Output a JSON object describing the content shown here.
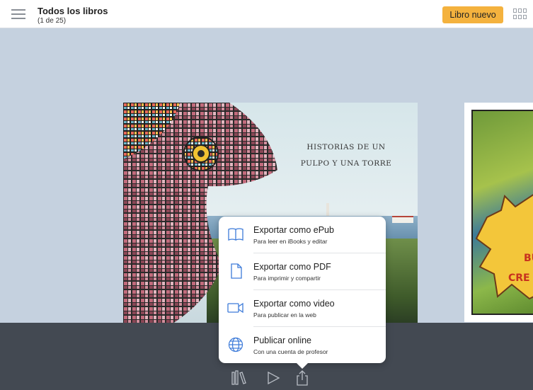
{
  "header": {
    "title": "Todos los libros",
    "subtitle": "(1 de 25)",
    "new_book_label": "Libro nuevo",
    "menu_icon": "hamburger-menu-icon",
    "view_icon": "grid-view-icon"
  },
  "books": [
    {
      "cover_title_line1": "Historias de un",
      "cover_title_line2": "pulpo y una torre"
    },
    {
      "cover_text": "BU CRE"
    }
  ],
  "export_menu": {
    "items": [
      {
        "label": "Exportar como ePub",
        "description": "Para leer en iBooks y editar",
        "icon": "book-open-icon"
      },
      {
        "label": "Exportar como PDF",
        "description": "Para imprimir y compartir",
        "icon": "document-icon"
      },
      {
        "label": "Exportar como video",
        "description": "Para publicar en la web",
        "icon": "video-camera-icon"
      },
      {
        "label": "Publicar online",
        "description": "Con una cuenta de profesor",
        "icon": "globe-icon"
      }
    ]
  },
  "bottom_toolbar": {
    "icons": [
      "library-icon",
      "play-icon",
      "share-icon"
    ]
  },
  "colors": {
    "accent": "#f4b23e",
    "background": "#c5d1df",
    "toolbar": "#434952",
    "icon_blue": "#3d7bd9"
  }
}
